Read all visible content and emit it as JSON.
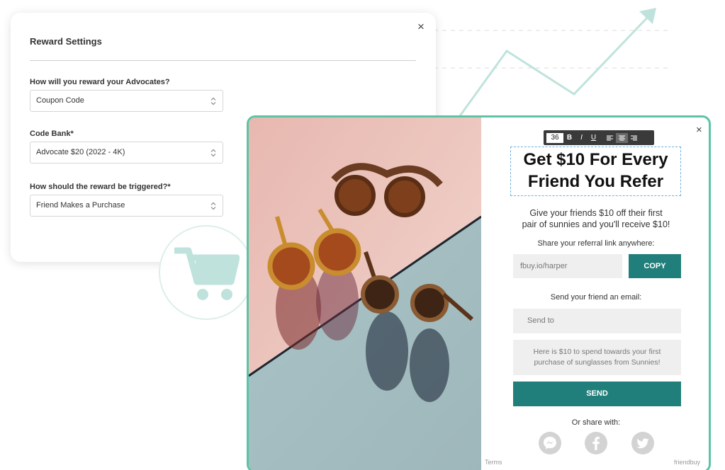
{
  "settings": {
    "title": "Reward Settings",
    "close_icon": "×",
    "fields": [
      {
        "label": "How will you reward your Advocates?",
        "value": "Coupon Code"
      },
      {
        "label": "Code Bank*",
        "value": "Advocate $20 (2022 - 4K)"
      },
      {
        "label": "How should the reward be triggered?*",
        "value": "Friend Makes a Purchase"
      }
    ]
  },
  "widget": {
    "close_icon": "×",
    "toolbar": {
      "font_size": "36",
      "bold": "B",
      "italic": "I",
      "underline": "U"
    },
    "headline_line1": "Get $10 For Every",
    "headline_line2": "Friend You Refer",
    "subtext_line1": "Give your friends $10 off their first",
    "subtext_line2": "pair of sunnies and you'll receive $10!",
    "share_label": "Share your referral link anywhere:",
    "referral_link": "fbuy.io/harper",
    "copy_label": "COPY",
    "email_label": "Send your friend an email:",
    "send_to_placeholder": "Send to",
    "message_line1": "Here is $10 to spend towards your first",
    "message_line2": "purchase of sunglasses from Sunnies!",
    "send_label": "SEND",
    "or_share_label": "Or share with:",
    "social_icons": [
      "messenger-icon",
      "facebook-icon",
      "twitter-icon"
    ],
    "terms_label": "Terms",
    "brand_label": "friendbuy"
  },
  "colors": {
    "accent": "#217f7b",
    "widget_border": "#5cc4a5",
    "deco_line": "#bfe3dc",
    "social_gray": "#d3d3d3"
  }
}
